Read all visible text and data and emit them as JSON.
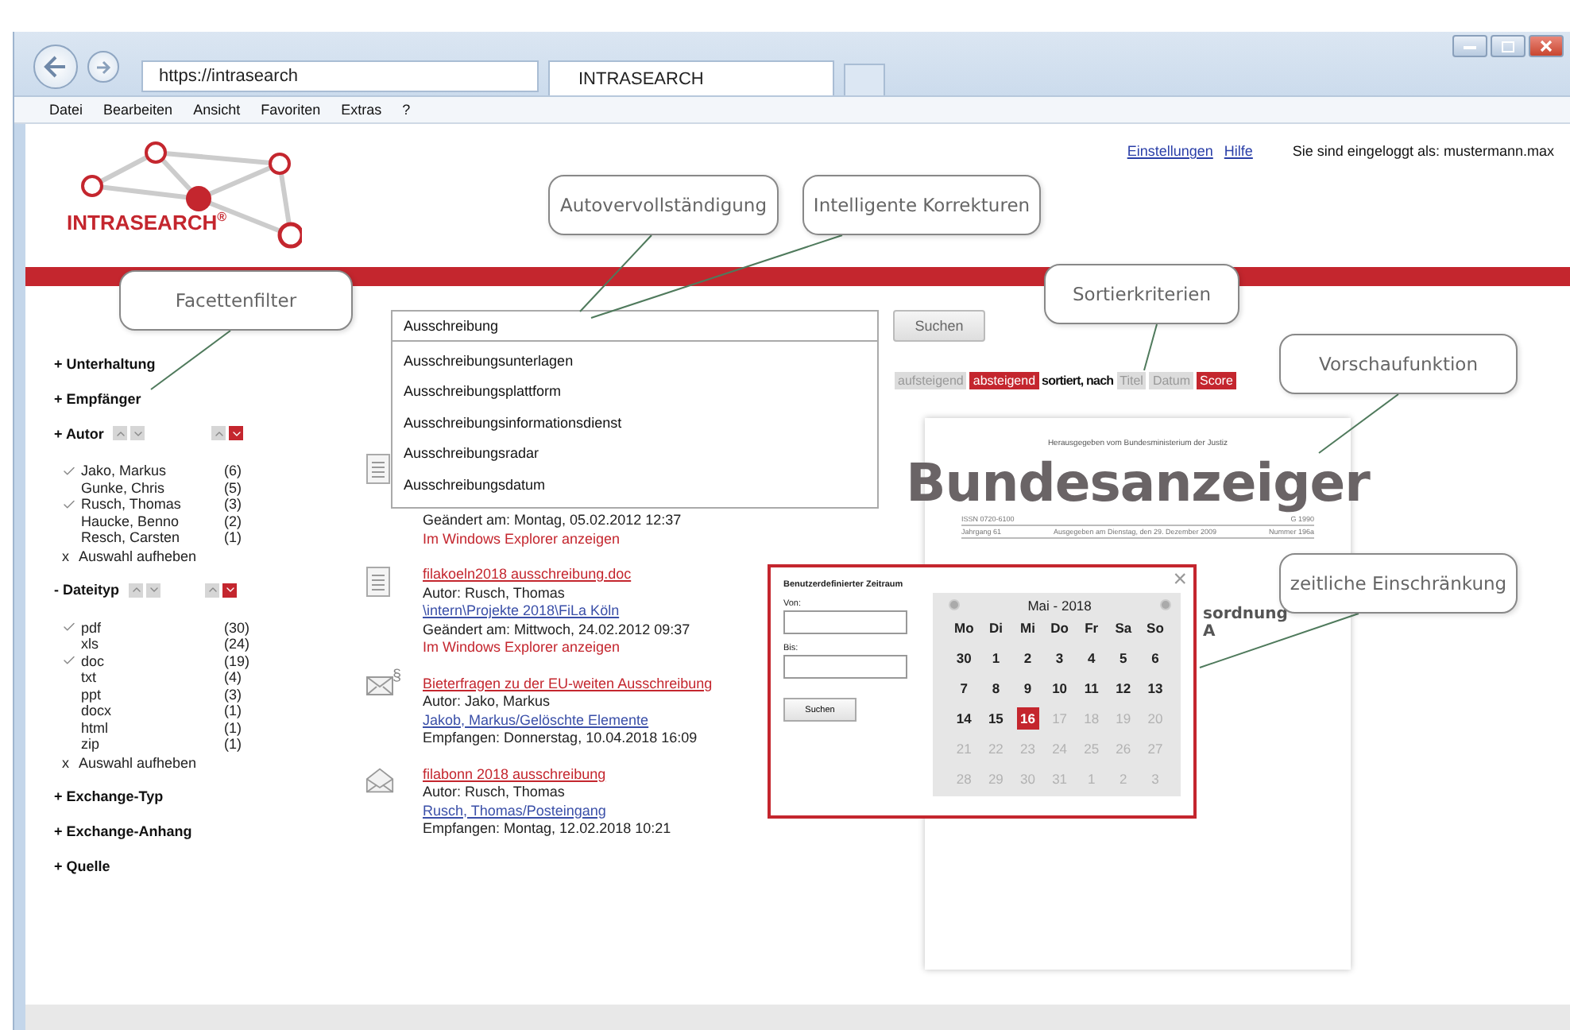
{
  "browser": {
    "url": "https://intrasearch",
    "tab": "INTRASEARCH",
    "menu": [
      "Datei",
      "Bearbeiten",
      "Ansicht",
      "Favoriten",
      "Extras",
      "?"
    ]
  },
  "header": {
    "logo": "INTRASEARCH$^{®}$",
    "links": [
      "Einstellungen",
      "Hilfe"
    ],
    "login": "Sie sind eingeloggt als: mustermann.max"
  },
  "facets": [
    {
      "toggle": "+",
      "label": "Unterhaltung"
    },
    {
      "toggle": "+",
      "label": "Empfänger"
    },
    {
      "toggle": "+",
      "label": "Autor",
      "sort_alpha": [
        {
          "selected": false
        },
        {
          "selected": false
        }
      ],
      "sort_count": [
        {
          "selected": false
        },
        {
          "selected": true
        }
      ],
      "clear_mark": "x",
      "clear": "Auswahl aufheben",
      "items": [
        {
          "label": "Jako, Markus",
          "count": "(6)",
          "checked": true
        },
        {
          "label": "Gunke, Chris",
          "count": "(5)",
          "checked": false
        },
        {
          "label": "Rusch, Thomas",
          "count": "(3)",
          "checked": true
        },
        {
          "label": "Haucke, Benno",
          "count": "(2)",
          "checked": false
        },
        {
          "label": "Resch, Carsten",
          "count": "(1)",
          "checked": false
        }
      ]
    },
    {
      "toggle": "-",
      "label": "Dateityp",
      "sort_alpha": [
        {
          "selected": false
        },
        {
          "selected": false
        }
      ],
      "sort_count": [
        {
          "selected": false
        },
        {
          "selected": true
        }
      ],
      "clear_mark": "x",
      "clear": "Auswahl aufheben",
      "items": [
        {
          "label": "pdf",
          "count": "(30)",
          "checked": true
        },
        {
          "label": "xls",
          "count": "(24)",
          "checked": false
        },
        {
          "label": "doc",
          "count": "(19)",
          "checked": true
        },
        {
          "label": "txt",
          "count": "(4)",
          "checked": false
        },
        {
          "label": "ppt",
          "count": "(3)",
          "checked": false
        },
        {
          "label": "docx",
          "count": "(1)",
          "checked": false
        },
        {
          "label": "html",
          "count": "(1)",
          "checked": false
        },
        {
          "label": "zip",
          "count": "(1)",
          "checked": false
        }
      ]
    },
    {
      "toggle": "+",
      "label": "Exchange-Typ"
    },
    {
      "toggle": "+",
      "label": "Exchange-Anhang"
    },
    {
      "toggle": "+",
      "label": "Quelle"
    }
  ],
  "search": {
    "value": "Ausschreibung",
    "button": "Suchen",
    "suggestions": [
      "Ausschreibungsunterlagen",
      "Ausschreibungsplattform",
      "Ausschreibungsinformationsdienst",
      "Ausschreibungsradar",
      "Ausschreibungsdatum"
    ]
  },
  "sort": {
    "orders": [
      {
        "label": "aufsteigend",
        "selected": false
      },
      {
        "label": "absteigend",
        "selected": true
      }
    ],
    "label": "sortiert, nach",
    "fields": [
      {
        "label": "Titel",
        "selected": false
      },
      {
        "label": "Datum",
        "selected": false
      },
      {
        "label": "Score",
        "selected": true
      }
    ]
  },
  "results": [
    {
      "kind": "document",
      "lines": [
        {
          "kind": "text",
          "text": "Geändert am: Montag, 05.02.2012 12:37"
        },
        {
          "kind": "action",
          "text": "Im Windows Explorer anzeigen"
        }
      ]
    },
    {
      "kind": "document",
      "lines": [
        {
          "kind": "title",
          "text": "filakoeln2018 ausschreibung.doc"
        },
        {
          "kind": "text",
          "text": "Autor: Rusch, Thomas"
        },
        {
          "kind": "path",
          "text": "\\intern\\Projekte 2018\\FiLa Köln"
        },
        {
          "kind": "text",
          "text": "Geändert am: Mittwoch, 24.02.2012 09:37"
        },
        {
          "kind": "action",
          "text": "Im Windows Explorer anzeigen"
        }
      ]
    },
    {
      "kind": "mail",
      "badge": "§",
      "lines": [
        {
          "kind": "title",
          "text": "Bieterfragen zu der EU-weiten Ausschreibung"
        },
        {
          "kind": "text",
          "text": "Autor: Jako, Markus"
        },
        {
          "kind": "path",
          "text": "Jakob, Markus/Gelöschte Elemente"
        },
        {
          "kind": "text",
          "text": "Empfangen: Donnerstag, 10.04.2018 16:09"
        }
      ]
    },
    {
      "kind": "open-mail",
      "lines": [
        {
          "kind": "title",
          "text": "filabonn 2018 ausschreibung"
        },
        {
          "kind": "text",
          "text": "Autor: Rusch, Thomas"
        },
        {
          "kind": "path",
          "text": "Rusch, Thomas/Posteingang"
        },
        {
          "kind": "text",
          "text": "Empfangen: Montag, 12.02.2018 10:21"
        }
      ]
    }
  ],
  "preview": {
    "publisher": "Herausgegeben vom Bundesministerium der Justiz",
    "title": "Bundesanzeiger",
    "issn": "ISSN 0720-6100",
    "code": "G 1990",
    "volume": "Jahrgang 61",
    "issued": "Ausgegeben am Dienstag, den 29. Dezember 2009",
    "number": "Nummer 196a",
    "fragments": [
      "sordnung",
      "A"
    ]
  },
  "date_popup": {
    "title": "Benutzerdefinierter Zeitraum",
    "close": "×",
    "fields": [
      {
        "label": "Von:"
      },
      {
        "label": "Bis:"
      }
    ],
    "button": "Suchen",
    "month": "Mai - 2018",
    "weekdays": [
      "Mo",
      "Di",
      "Mi",
      "Do",
      "Fr",
      "Sa",
      "So"
    ],
    "weeks": [
      [
        {
          "day": "30",
          "muted": false,
          "selected": false
        },
        {
          "day": "1",
          "muted": false,
          "selected": false
        },
        {
          "day": "2",
          "muted": false,
          "selected": false
        },
        {
          "day": "3",
          "muted": false,
          "selected": false
        },
        {
          "day": "4",
          "muted": false,
          "selected": false
        },
        {
          "day": "5",
          "muted": false,
          "selected": false
        },
        {
          "day": "6",
          "muted": false,
          "selected": false
        }
      ],
      [
        {
          "day": "7",
          "muted": false,
          "selected": false
        },
        {
          "day": "8",
          "muted": false,
          "selected": false
        },
        {
          "day": "9",
          "muted": false,
          "selected": false
        },
        {
          "day": "10",
          "muted": false,
          "selected": false
        },
        {
          "day": "11",
          "muted": false,
          "selected": false
        },
        {
          "day": "12",
          "muted": false,
          "selected": false
        },
        {
          "day": "13",
          "muted": false,
          "selected": false
        }
      ],
      [
        {
          "day": "14",
          "muted": false,
          "selected": false
        },
        {
          "day": "15",
          "muted": false,
          "selected": false
        },
        {
          "day": "16",
          "muted": false,
          "selected": true
        },
        {
          "day": "17",
          "muted": true,
          "selected": false
        },
        {
          "day": "18",
          "muted": true,
          "selected": false
        },
        {
          "day": "19",
          "muted": true,
          "selected": false
        },
        {
          "day": "20",
          "muted": true,
          "selected": false
        }
      ],
      [
        {
          "day": "21",
          "muted": true,
          "selected": false
        },
        {
          "day": "22",
          "muted": true,
          "selected": false
        },
        {
          "day": "23",
          "muted": true,
          "selected": false
        },
        {
          "day": "24",
          "muted": true,
          "selected": false
        },
        {
          "day": "25",
          "muted": true,
          "selected": false
        },
        {
          "day": "26",
          "muted": true,
          "selected": false
        },
        {
          "day": "27",
          "muted": true,
          "selected": false
        }
      ],
      [
        {
          "day": "28",
          "muted": true,
          "selected": false
        },
        {
          "day": "29",
          "muted": true,
          "selected": false
        },
        {
          "day": "30",
          "muted": true,
          "selected": false
        },
        {
          "day": "31",
          "muted": true,
          "selected": false
        },
        {
          "day": "1",
          "muted": true,
          "selected": false
        },
        {
          "day": "2",
          "muted": true,
          "selected": false
        },
        {
          "day": "3",
          "muted": true,
          "selected": false
        }
      ]
    ]
  },
  "callouts": [
    "Facettenfilter",
    "Autovervollständigung",
    "Intelligente Korrekturen",
    "Sortierkriterien",
    "Vorschaufunktion",
    "zeitliche Einschränkung"
  ]
}
